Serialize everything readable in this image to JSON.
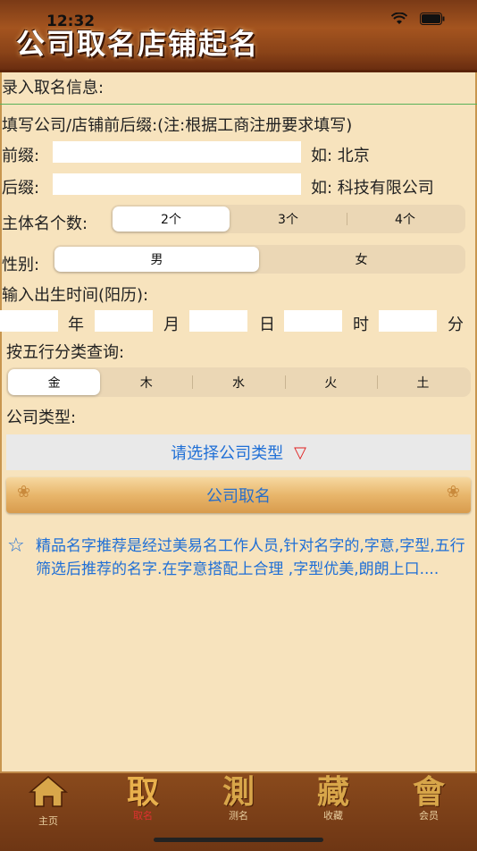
{
  "status": {
    "time": "12:32"
  },
  "header": {
    "title": "公司取名店铺起名"
  },
  "form": {
    "section_title": "录入取名信息:",
    "prefix_suffix_title": "填写公司/店铺前后缀:(注:根据工商注册要求填写)",
    "prefix_label": "前缀:",
    "prefix_hint": "如: 北京",
    "suffix_label": "后缀:",
    "suffix_hint": "如: 科技有限公司",
    "name_count_label": "主体名个数:",
    "name_count_options": [
      "2个",
      "3个",
      "4个"
    ],
    "name_count_selected": "2个",
    "gender_label": "性别:",
    "gender_options": [
      "男",
      "女"
    ],
    "gender_selected": "男",
    "birth_label": "输入出生时间(阳历):",
    "birth_units": [
      "年",
      "月",
      "日",
      "时",
      "分"
    ],
    "wuxing_label": "按五行分类查询:",
    "wuxing_options": [
      "金",
      "木",
      "水",
      "火",
      "土"
    ],
    "wuxing_selected": "金",
    "company_type_label": "公司类型:",
    "company_type_select": "请选择公司类型",
    "submit_label": "公司取名"
  },
  "recommendation": "精品名字推荐是经过美易名工作人员,针对名字的,字意,字型,五行筛选后推荐的名字.在字意搭配上合理 ,字型优美,朗朗上口....",
  "tabbar": [
    {
      "glyph": "⌂",
      "label": "主页"
    },
    {
      "glyph": "取",
      "label": "取名"
    },
    {
      "glyph": "測",
      "label": "测名"
    },
    {
      "glyph": "藏",
      "label": "收藏"
    },
    {
      "glyph": "會",
      "label": "会员"
    }
  ],
  "tabbar_active": "取名"
}
